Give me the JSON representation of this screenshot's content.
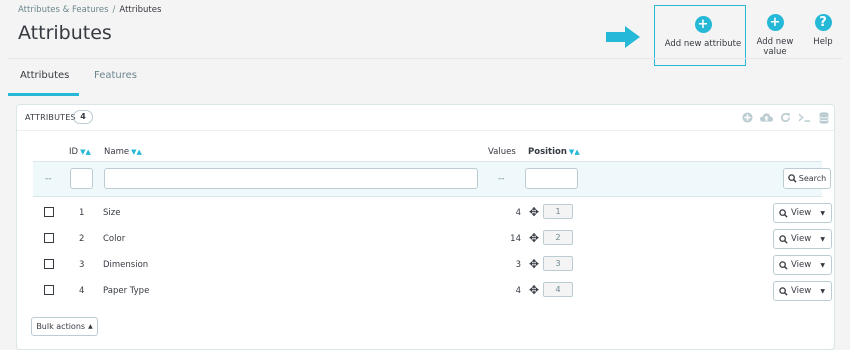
{
  "breadcrumb": {
    "parent": "Attributes & Features",
    "separator": "/",
    "current": "Attributes"
  },
  "page": {
    "title": "Attributes"
  },
  "toolbar": {
    "add_attribute": "Add new attribute",
    "add_value": "Add new value",
    "help": "Help",
    "add_icon": "plus-circle-icon",
    "help_icon": "question-circle-icon",
    "arrow_icon": "arrow-right-icon"
  },
  "tabs": [
    {
      "label": "Attributes",
      "active": true
    },
    {
      "label": "Features",
      "active": false
    }
  ],
  "panel": {
    "title": "ATTRIBUTES",
    "count": "4",
    "icons": [
      "add-icon",
      "cloud-upload-icon",
      "refresh-icon",
      "terminal-icon",
      "database-icon"
    ]
  },
  "table": {
    "headers": {
      "id": "ID",
      "name": "Name",
      "values": "Values",
      "position": "Position"
    },
    "filter": {
      "dash": "--",
      "values_dash": "--",
      "search_label": "Search"
    },
    "rows": [
      {
        "id": "1",
        "name": "Size",
        "values": "4",
        "position": "1"
      },
      {
        "id": "2",
        "name": "Color",
        "values": "14",
        "position": "2"
      },
      {
        "id": "3",
        "name": "Dimension",
        "values": "3",
        "position": "3"
      },
      {
        "id": "4",
        "name": "Paper Type",
        "values": "4",
        "position": "4"
      }
    ],
    "row_action": "View",
    "bulk_actions": "Bulk actions"
  },
  "colors": {
    "accent": "#25b9d7",
    "text": "#363a41",
    "muted": "#6c868e"
  }
}
